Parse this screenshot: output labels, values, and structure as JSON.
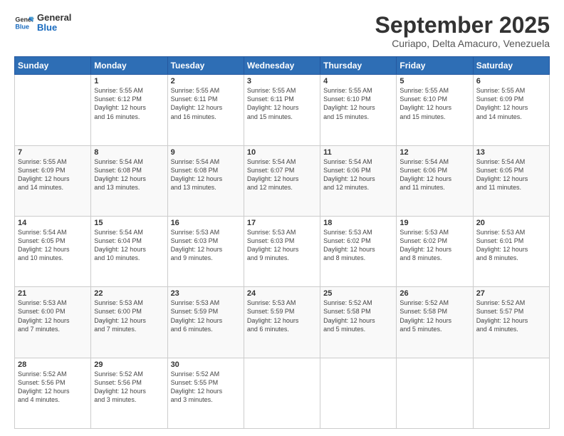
{
  "logo": {
    "text_general": "General",
    "text_blue": "Blue"
  },
  "header": {
    "month": "September 2025",
    "location": "Curiapo, Delta Amacuro, Venezuela"
  },
  "weekdays": [
    "Sunday",
    "Monday",
    "Tuesday",
    "Wednesday",
    "Thursday",
    "Friday",
    "Saturday"
  ],
  "weeks": [
    [
      {
        "day": "",
        "info": ""
      },
      {
        "day": "1",
        "info": "Sunrise: 5:55 AM\nSunset: 6:12 PM\nDaylight: 12 hours\nand 16 minutes."
      },
      {
        "day": "2",
        "info": "Sunrise: 5:55 AM\nSunset: 6:11 PM\nDaylight: 12 hours\nand 16 minutes."
      },
      {
        "day": "3",
        "info": "Sunrise: 5:55 AM\nSunset: 6:11 PM\nDaylight: 12 hours\nand 15 minutes."
      },
      {
        "day": "4",
        "info": "Sunrise: 5:55 AM\nSunset: 6:10 PM\nDaylight: 12 hours\nand 15 minutes."
      },
      {
        "day": "5",
        "info": "Sunrise: 5:55 AM\nSunset: 6:10 PM\nDaylight: 12 hours\nand 15 minutes."
      },
      {
        "day": "6",
        "info": "Sunrise: 5:55 AM\nSunset: 6:09 PM\nDaylight: 12 hours\nand 14 minutes."
      }
    ],
    [
      {
        "day": "7",
        "info": "Sunrise: 5:55 AM\nSunset: 6:09 PM\nDaylight: 12 hours\nand 14 minutes."
      },
      {
        "day": "8",
        "info": "Sunrise: 5:54 AM\nSunset: 6:08 PM\nDaylight: 12 hours\nand 13 minutes."
      },
      {
        "day": "9",
        "info": "Sunrise: 5:54 AM\nSunset: 6:08 PM\nDaylight: 12 hours\nand 13 minutes."
      },
      {
        "day": "10",
        "info": "Sunrise: 5:54 AM\nSunset: 6:07 PM\nDaylight: 12 hours\nand 12 minutes."
      },
      {
        "day": "11",
        "info": "Sunrise: 5:54 AM\nSunset: 6:06 PM\nDaylight: 12 hours\nand 12 minutes."
      },
      {
        "day": "12",
        "info": "Sunrise: 5:54 AM\nSunset: 6:06 PM\nDaylight: 12 hours\nand 11 minutes."
      },
      {
        "day": "13",
        "info": "Sunrise: 5:54 AM\nSunset: 6:05 PM\nDaylight: 12 hours\nand 11 minutes."
      }
    ],
    [
      {
        "day": "14",
        "info": "Sunrise: 5:54 AM\nSunset: 6:05 PM\nDaylight: 12 hours\nand 10 minutes."
      },
      {
        "day": "15",
        "info": "Sunrise: 5:54 AM\nSunset: 6:04 PM\nDaylight: 12 hours\nand 10 minutes."
      },
      {
        "day": "16",
        "info": "Sunrise: 5:53 AM\nSunset: 6:03 PM\nDaylight: 12 hours\nand 9 minutes."
      },
      {
        "day": "17",
        "info": "Sunrise: 5:53 AM\nSunset: 6:03 PM\nDaylight: 12 hours\nand 9 minutes."
      },
      {
        "day": "18",
        "info": "Sunrise: 5:53 AM\nSunset: 6:02 PM\nDaylight: 12 hours\nand 8 minutes."
      },
      {
        "day": "19",
        "info": "Sunrise: 5:53 AM\nSunset: 6:02 PM\nDaylight: 12 hours\nand 8 minutes."
      },
      {
        "day": "20",
        "info": "Sunrise: 5:53 AM\nSunset: 6:01 PM\nDaylight: 12 hours\nand 8 minutes."
      }
    ],
    [
      {
        "day": "21",
        "info": "Sunrise: 5:53 AM\nSunset: 6:00 PM\nDaylight: 12 hours\nand 7 minutes."
      },
      {
        "day": "22",
        "info": "Sunrise: 5:53 AM\nSunset: 6:00 PM\nDaylight: 12 hours\nand 7 minutes."
      },
      {
        "day": "23",
        "info": "Sunrise: 5:53 AM\nSunset: 5:59 PM\nDaylight: 12 hours\nand 6 minutes."
      },
      {
        "day": "24",
        "info": "Sunrise: 5:53 AM\nSunset: 5:59 PM\nDaylight: 12 hours\nand 6 minutes."
      },
      {
        "day": "25",
        "info": "Sunrise: 5:52 AM\nSunset: 5:58 PM\nDaylight: 12 hours\nand 5 minutes."
      },
      {
        "day": "26",
        "info": "Sunrise: 5:52 AM\nSunset: 5:58 PM\nDaylight: 12 hours\nand 5 minutes."
      },
      {
        "day": "27",
        "info": "Sunrise: 5:52 AM\nSunset: 5:57 PM\nDaylight: 12 hours\nand 4 minutes."
      }
    ],
    [
      {
        "day": "28",
        "info": "Sunrise: 5:52 AM\nSunset: 5:56 PM\nDaylight: 12 hours\nand 4 minutes."
      },
      {
        "day": "29",
        "info": "Sunrise: 5:52 AM\nSunset: 5:56 PM\nDaylight: 12 hours\nand 3 minutes."
      },
      {
        "day": "30",
        "info": "Sunrise: 5:52 AM\nSunset: 5:55 PM\nDaylight: 12 hours\nand 3 minutes."
      },
      {
        "day": "",
        "info": ""
      },
      {
        "day": "",
        "info": ""
      },
      {
        "day": "",
        "info": ""
      },
      {
        "day": "",
        "info": ""
      }
    ]
  ]
}
